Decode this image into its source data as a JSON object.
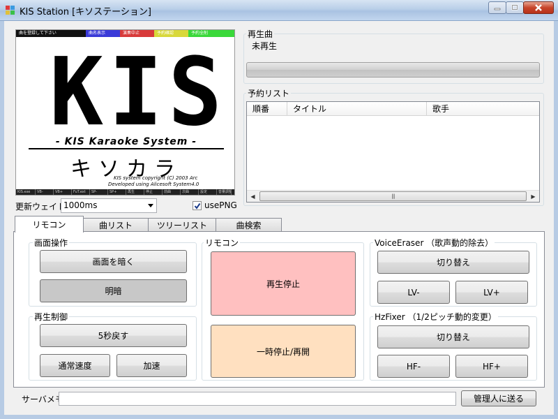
{
  "window": {
    "title": "KIS Station [キソステーション]"
  },
  "logo": {
    "big_text": "KIS",
    "subtitle": "- KIS Karaoke System -",
    "kana": "キソカラ",
    "copyright_line1": "KIS system copyright (C) 2003 Arc",
    "copyright_line2": "Developed using Alicesoft System4.0",
    "top_bar": [
      {
        "label": "曲を登録して下さい",
        "color": "#111111"
      },
      {
        "label": "曲名表示",
        "color": "#3a3ad8"
      },
      {
        "label": "演奏中止",
        "color": "#d83a3a"
      },
      {
        "label": "予約確認",
        "color": "#d8d83a"
      },
      {
        "label": "予約全削",
        "color": "#3ad83a"
      }
    ],
    "bottom_bar": [
      "KIS.exe",
      "VB-",
      "VB+",
      "FuT.ext",
      "SP-",
      "SP+",
      "再生",
      "停止",
      "前曲",
      "次曲",
      "設定",
      "音量調整"
    ]
  },
  "now_playing": {
    "group_label": "再生曲",
    "status": "未再生",
    "progress": 0
  },
  "reservation": {
    "group_label": "予約リスト",
    "columns": [
      "順番",
      "タイトル",
      "歌手"
    ],
    "scroll_grip": "|||"
  },
  "settings": {
    "update_wait_label": "更新ウェイト",
    "update_wait_value": "1000ms",
    "use_png_label": "usePNG",
    "use_png_checked": true
  },
  "tabs": [
    "リモコン",
    "曲リスト",
    "ツリーリスト",
    "曲検索"
  ],
  "remote": {
    "screen_group": "画面操作",
    "darken": "画面を暗く",
    "brightness": "明暗",
    "playback_group": "再生制御",
    "rewind5": "5秒戻す",
    "normal_speed": "通常速度",
    "speed_up": "加速",
    "remote_group": "リモコン",
    "stop": "再生停止",
    "pause": "一時停止/再開",
    "voice_group": "VoiceEraser （歌声動的除去）",
    "voice_toggle": "切り替え",
    "lv_minus": "LV-",
    "lv_plus": "LV+",
    "hz_group": "HzFixer （1/2ピッチ動的変更）",
    "hz_toggle": "切り替え",
    "hf_minus": "HF-",
    "hf_plus": "HF+"
  },
  "memo": {
    "label": "サーバメモ",
    "value": "",
    "send": "管理人に送る"
  },
  "colors": {
    "stop_button": "#ffc0c0",
    "pause_button": "#ffe0c0",
    "pressed_button": "#c8c8c8"
  }
}
